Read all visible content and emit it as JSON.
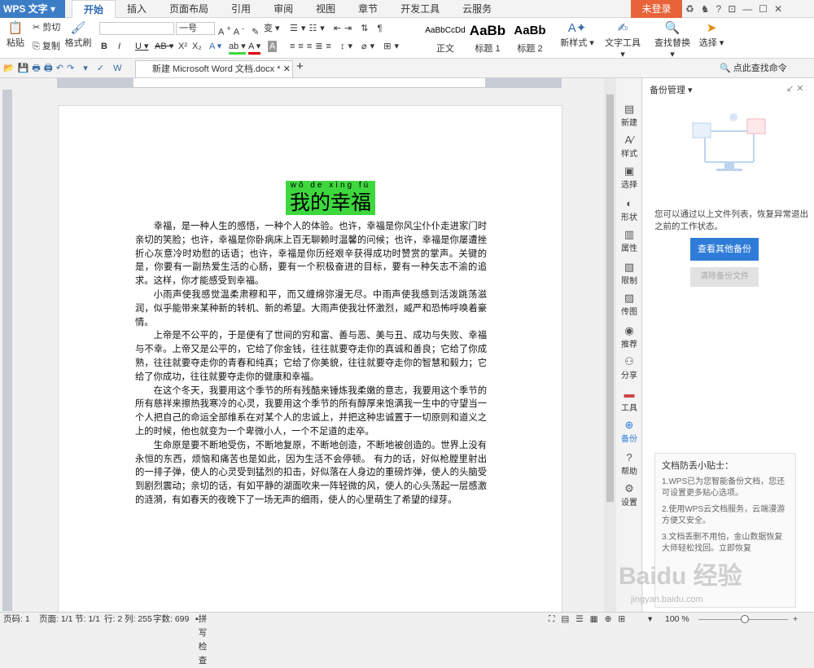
{
  "app": {
    "name": "WPS 文字",
    "login": "未登录"
  },
  "tabs": [
    "开始",
    "插入",
    "页面布局",
    "引用",
    "审阅",
    "视图",
    "章节",
    "开发工具",
    "云服务"
  ],
  "ribbon": {
    "paste": "粘贴",
    "cut": "剪切",
    "copy": "复制",
    "format_painter": "格式刷",
    "font_size": "一号",
    "styles": [
      {
        "preview": "AaBbCcDd",
        "name": "正文"
      },
      {
        "preview": "AaBb",
        "name": "标题 1"
      },
      {
        "preview": "AaBb",
        "name": "标题 2"
      }
    ],
    "new_style": "新样式",
    "text_tools": "文字工具",
    "find_replace": "查找替换",
    "select": "选择"
  },
  "doc_tab": {
    "name": "新建 Microsoft Word 文档.docx *"
  },
  "search_cmd": "点此查找命令",
  "document": {
    "pinyin": "wǒ de xìng fú",
    "title": "我的幸福",
    "paragraphs": [
      "幸福，是一种人生的感悟，一种个人的体验。也许，幸福是你风尘仆仆走进家门时亲切的笑脸；也许，幸福是你卧病床上百无聊赖时温馨的问候；也许，幸福是你屡遭挫折心灰意冷时劝慰的话语；也许，幸福是你历经艰辛获得成功时赞赏的掌声。关键的是，你要有一副热爱生活的心肠，要有一个积极奋进的目标，要有一种矢志不渝的追求。这样，你才能感受到幸福。",
      "小雨声使我感觉温柔肃穆和平，而又缠绵弥漫无尽。中雨声使我感到活泼跳荡滋润，似乎能带来某种新的转机、新的希望。大雨声使我壮怀激烈，威严和恐怖呼唤着豪情。",
      "上帝是不公平的，于是便有了世间的穷和富、善与恶、美与丑、成功与失败、幸福与不幸。上帝又是公平的，它给了你金钱，往往就要夺走你的真诚和善良；它给了你成熟，往往就要夺走你的青春和纯真；它给了你美貌，往往就要夺走你的智慧和毅力；它给了你成功，往往就要夺走你的健康和幸福。",
      "在这个冬天，我要用这个季节的所有残酷来锤炼我柔嫩的意志，我要用这个季节的所有慈祥来擦热我寒冷的心灵，我要用这个季节的所有醇厚来饱满我一生中的守望当一个人把自己的命运全部维系在对某个人的忠诚上，并把这种忠诚置于一切原则和道义之上的时候，他也就变为一个卑微小人，一个不足道的走卒。",
      "生命原是要不断地受伤，不断地复原，不断地创造，不断地被创造的。世界上没有永恒的东西，烦恼和痛苦也是如此，因为生活不会停顿。 有力的话，好似枪膛里射出的一排子弹，使人的心灵受到猛烈的扣击，好似落在人身边的重磅炸弹，使人的头脑受到剧烈震动；亲切的话，有如平静的湖面吹来一阵轻微的风，使人的心头荡起一层感激的涟漪，有如春天的夜晚下了一场无声的细雨，使人的心里萌生了希望的绿芽。"
    ]
  },
  "sidebar": [
    "新建",
    "样式",
    "选择",
    "形状",
    "属性",
    "限制",
    "传图",
    "推荐",
    "分享",
    "工具",
    "备份",
    "帮助",
    "设置"
  ],
  "panel": {
    "title": "备份管理",
    "desc": "您可以通过以上文件列表，恢复异常退出之前的工作状态。",
    "view_btn": "查看其他备份",
    "clear_btn": "清除备份文件",
    "tips_title": "文档防丢小贴士：",
    "tips": [
      "1.WPS已为您智能备份文档，您还可设置更多贴心选项。",
      "2.使用WPS云文档服务，云端漫游方便又安全。",
      "3.文档丢删不用怕，金山数据恢复大师轻松找回。立即恢复"
    ]
  },
  "status": {
    "page": "页码: 1",
    "pages": "页面: 1/1",
    "section": "节: 1/1",
    "row": "行: 2",
    "col": "列: 255",
    "words": "字数: 699",
    "spell": "拼写检查",
    "zoom": "100 %"
  },
  "watermark": "Baidu 经验",
  "watermark_url": "jingyan.baidu.com"
}
